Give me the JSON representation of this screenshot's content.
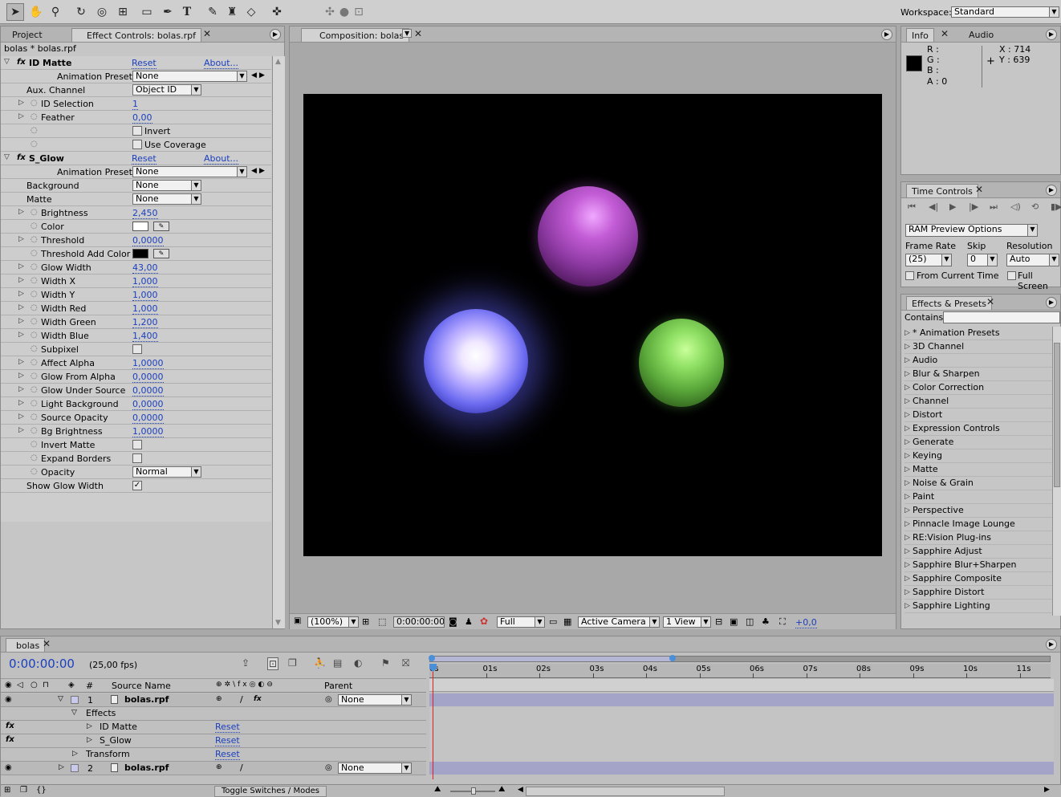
{
  "toolbar": {
    "workspace_label": "Workspace:",
    "workspace_value": "Standard"
  },
  "left_panel": {
    "tabs": [
      "Project",
      "Effect Controls: bolas.rpf"
    ],
    "layer_path": "bolas * bolas.rpf",
    "id_matte": {
      "name": "ID Matte",
      "reset": "Reset",
      "about": "About...",
      "presets_label": "Animation Presets:",
      "presets_value": "None",
      "rows": [
        {
          "label": "Aux. Channel",
          "type": "dropdown",
          "value": "Object ID"
        },
        {
          "label": "ID Selection",
          "type": "link",
          "value": "1"
        },
        {
          "label": "Feather",
          "type": "link",
          "value": "0,00"
        },
        {
          "label": "",
          "type": "checkbox",
          "value": "Invert"
        },
        {
          "label": "",
          "type": "checkbox",
          "value": "Use Coverage"
        }
      ]
    },
    "s_glow": {
      "name": "S_Glow",
      "reset": "Reset",
      "about": "About...",
      "presets_label": "Animation Presets:",
      "presets_value": "None",
      "rows": [
        {
          "label": "Background",
          "type": "dropdown",
          "value": "None"
        },
        {
          "label": "Matte",
          "type": "dropdown",
          "value": "None"
        },
        {
          "label": "Brightness",
          "type": "link",
          "value": "2,450"
        },
        {
          "label": "Color",
          "type": "color",
          "value": "#ffffff"
        },
        {
          "label": "Threshold",
          "type": "link",
          "value": "0,0000"
        },
        {
          "label": "Threshold Add Color",
          "type": "color",
          "value": "#000000"
        },
        {
          "label": "Glow Width",
          "type": "link",
          "value": "43,00"
        },
        {
          "label": "Width X",
          "type": "link",
          "value": "1,000"
        },
        {
          "label": "Width Y",
          "type": "link",
          "value": "1,000"
        },
        {
          "label": "Width Red",
          "type": "link",
          "value": "1,000"
        },
        {
          "label": "Width Green",
          "type": "link",
          "value": "1,200"
        },
        {
          "label": "Width Blue",
          "type": "link",
          "value": "1,400"
        },
        {
          "label": "Subpixel",
          "type": "box",
          "value": ""
        },
        {
          "label": "Affect Alpha",
          "type": "link",
          "value": "1,0000"
        },
        {
          "label": "Glow From Alpha",
          "type": "link",
          "value": "0,0000"
        },
        {
          "label": "Glow Under Source",
          "type": "link",
          "value": "0,0000"
        },
        {
          "label": "Light Background",
          "type": "link",
          "value": "0,0000"
        },
        {
          "label": "Source Opacity",
          "type": "link",
          "value": "0,0000"
        },
        {
          "label": "Bg Brightness",
          "type": "link",
          "value": "1,0000"
        },
        {
          "label": "Invert Matte",
          "type": "box",
          "value": ""
        },
        {
          "label": "Expand Borders",
          "type": "box",
          "value": ""
        },
        {
          "label": "Opacity",
          "type": "dropdown",
          "value": "Normal"
        },
        {
          "label": "Show Glow Width",
          "type": "checked",
          "value": ""
        }
      ]
    }
  },
  "composition": {
    "tab": "Composition: bolas",
    "zoom": "(100%)",
    "timecode": "0:00:00:00",
    "resolution": "Full",
    "camera": "Active Camera",
    "views": "1 View",
    "exposure": "+0,0"
  },
  "info_panel": {
    "tabs": [
      "Info",
      "Audio"
    ],
    "r": "R :",
    "g": "G :",
    "b": "B :",
    "a": "A : 0",
    "x": "X : 714",
    "y": "Y : 639"
  },
  "time_controls": {
    "tab": "Time Controls",
    "ram_preview": "RAM Preview Options",
    "frame_rate_label": "Frame Rate",
    "skip_label": "Skip",
    "resolution_label": "Resolution",
    "frame_rate_value": "(25)",
    "skip_value": "0",
    "resolution_value": "Auto",
    "from_current": "From Current Time",
    "full_screen": "Full Screen"
  },
  "effects_presets": {
    "tab": "Effects & Presets",
    "contains_label": "Contains:",
    "items": [
      "* Animation Presets",
      "3D Channel",
      "Audio",
      "Blur & Sharpen",
      "Color Correction",
      "Channel",
      "Distort",
      "Expression Controls",
      "Generate",
      "Keying",
      "Matte",
      "Noise & Grain",
      "Paint",
      "Perspective",
      "Pinnacle Image Lounge",
      "RE:Vision Plug-ins",
      "Sapphire Adjust",
      "Sapphire Blur+Sharpen",
      "Sapphire Composite",
      "Sapphire Distort",
      "Sapphire Lighting"
    ]
  },
  "timeline": {
    "tab": "bolas",
    "timecode": "0:00:00:00",
    "fps": "(25,00 fps)",
    "col_num": "#",
    "col_source": "Source Name",
    "col_parent": "Parent",
    "ruler": [
      "0s",
      "01s",
      "02s",
      "03s",
      "04s",
      "05s",
      "06s",
      "07s",
      "08s",
      "09s",
      "10s",
      "11s"
    ],
    "layer1_num": "1",
    "layer1_name": "bolas.rpf",
    "layer1_parent": "None",
    "effects_label": "Effects",
    "fx1": "ID Matte",
    "fx2": "S_Glow",
    "transform": "Transform",
    "reset": "Reset",
    "layer2_num": "2",
    "layer2_name": "bolas.rpf",
    "layer2_parent": "None",
    "toggle": "Toggle Switches / Modes"
  }
}
